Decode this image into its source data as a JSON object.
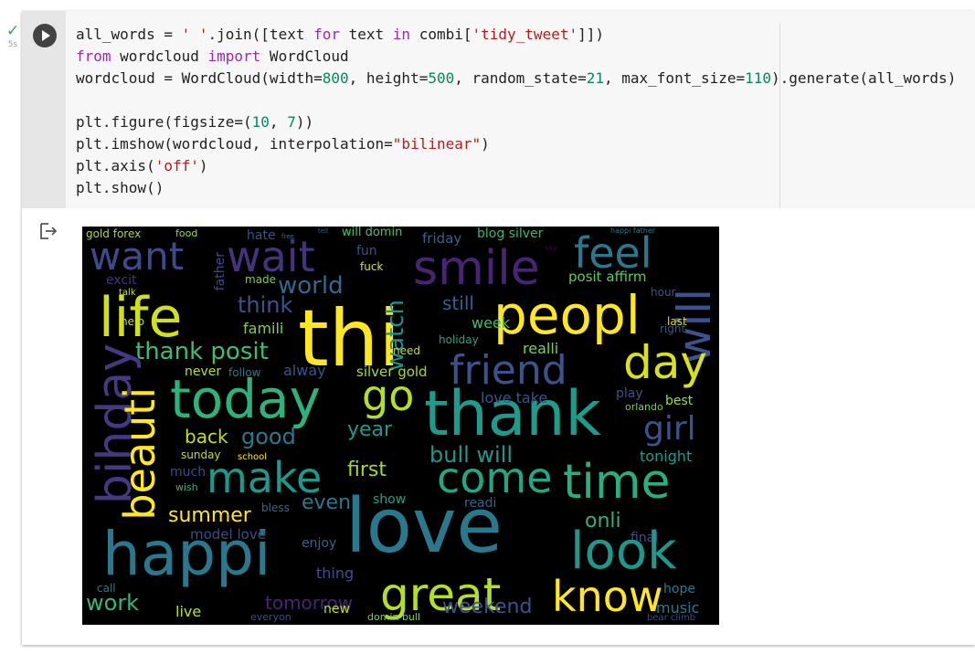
{
  "cell_status": {
    "check": "✓",
    "elapsed": "5s"
  },
  "code_lines": [
    [
      {
        "t": "all_words = ",
        "c": ""
      },
      {
        "t": "' '",
        "c": "str"
      },
      {
        "t": ".join([text ",
        "c": ""
      },
      {
        "t": "for",
        "c": "kw"
      },
      {
        "t": " text ",
        "c": ""
      },
      {
        "t": "in",
        "c": "kw"
      },
      {
        "t": " combi[",
        "c": ""
      },
      {
        "t": "'tidy_tweet'",
        "c": "str"
      },
      {
        "t": "]])",
        "c": ""
      }
    ],
    [
      {
        "t": "from",
        "c": "kw"
      },
      {
        "t": " wordcloud ",
        "c": ""
      },
      {
        "t": "import",
        "c": "kw"
      },
      {
        "t": " WordCloud",
        "c": ""
      }
    ],
    [
      {
        "t": "wordcloud = WordCloud(width=",
        "c": ""
      },
      {
        "t": "800",
        "c": "num"
      },
      {
        "t": ", height=",
        "c": ""
      },
      {
        "t": "500",
        "c": "num"
      },
      {
        "t": ", random_state=",
        "c": ""
      },
      {
        "t": "21",
        "c": "num"
      },
      {
        "t": ", max_font_size=",
        "c": ""
      },
      {
        "t": "110",
        "c": "num"
      },
      {
        "t": ").generate(all_words)",
        "c": ""
      }
    ],
    [],
    [
      {
        "t": "plt.figure(figsize=(",
        "c": ""
      },
      {
        "t": "10",
        "c": "num"
      },
      {
        "t": ", ",
        "c": ""
      },
      {
        "t": "7",
        "c": "num"
      },
      {
        "t": "))",
        "c": ""
      }
    ],
    [
      {
        "t": "plt.imshow(wordcloud, interpolation=",
        "c": ""
      },
      {
        "t": "\"bilinear\"",
        "c": "str"
      },
      {
        "t": ")",
        "c": ""
      }
    ],
    [
      {
        "t": "plt.axis(",
        "c": ""
      },
      {
        "t": "'off'",
        "c": "str"
      },
      {
        "t": ")",
        "c": ""
      }
    ],
    [
      {
        "t": "plt.show()",
        "c": ""
      }
    ]
  ],
  "wordcloud_words": [
    {
      "t": "gold forex",
      "c": "#a6d93a"
    },
    {
      "t": "food",
      "c": "#9bd93c"
    },
    {
      "t": "hate",
      "c": "#3b528b"
    },
    {
      "t": "free",
      "c": "#2d708e"
    },
    {
      "t": "tell",
      "c": "#33638d"
    },
    {
      "t": "will domin",
      "c": "#48c16e"
    },
    {
      "t": "friday",
      "c": "#33638d"
    },
    {
      "t": "blog silver",
      "c": "#35b779"
    },
    {
      "t": "happi father",
      "c": "#2a788e"
    },
    {
      "t": "want",
      "c": "#3e4a89"
    },
    {
      "t": "wait",
      "c": "#46337e"
    },
    {
      "t": "smile",
      "c": "#482475"
    },
    {
      "t": "feel",
      "c": "#2a788e"
    },
    {
      "t": "life",
      "c": "#d0e11c"
    },
    {
      "t": "thi",
      "c": "#fde725"
    },
    {
      "t": "peopl",
      "c": "#fde725"
    },
    {
      "t": "will",
      "c": "#3b528b"
    },
    {
      "t": "world",
      "c": "#31688e"
    },
    {
      "t": "think",
      "c": "#3b528b"
    },
    {
      "t": "watch",
      "c": "#21918c"
    },
    {
      "t": "posit affirm",
      "c": "#5ec962"
    },
    {
      "t": "father",
      "c": "#3e4a89"
    },
    {
      "t": "fun",
      "c": "#3b528b"
    },
    {
      "t": "fuck",
      "c": "#d8e219"
    },
    {
      "t": "say",
      "c": "#440154"
    },
    {
      "t": "excit",
      "c": "#46337e"
    },
    {
      "t": "made",
      "c": "#7ad151"
    },
    {
      "t": "talk",
      "c": "#c2df23"
    },
    {
      "t": "still",
      "c": "#33638d"
    },
    {
      "t": "hour",
      "c": "#3b528b"
    },
    {
      "t": "famili",
      "c": "#7ad151"
    },
    {
      "t": "week",
      "c": "#3fbc73"
    },
    {
      "t": "last",
      "c": "#d8e219"
    },
    {
      "t": "right",
      "c": "#3b528b"
    },
    {
      "t": "help",
      "c": "#c2df23"
    },
    {
      "t": "thank posit",
      "c": "#3fbc73"
    },
    {
      "t": "realli",
      "c": "#7ad151"
    },
    {
      "t": "holiday",
      "c": "#20a486"
    },
    {
      "t": "day",
      "c": "#d8e219"
    },
    {
      "t": "friend",
      "c": "#3b528b"
    },
    {
      "t": "bihday",
      "c": "#443983"
    },
    {
      "t": "never",
      "c": "#b5de2b"
    },
    {
      "t": "follow",
      "c": "#2a788e"
    },
    {
      "t": "alway",
      "c": "#3b528b"
    },
    {
      "t": "silver gold",
      "c": "#a0da39"
    },
    {
      "t": "need",
      "c": "#c2df23"
    },
    {
      "t": "today",
      "c": "#2db27d"
    },
    {
      "t": "go",
      "c": "#b5de2b"
    },
    {
      "t": "thank",
      "c": "#1e9b8a"
    },
    {
      "t": "love take",
      "c": "#3b528b"
    },
    {
      "t": "play",
      "c": "#3b528b"
    },
    {
      "t": "best",
      "c": "#a0da39"
    },
    {
      "t": "beauti",
      "c": "#fde725"
    },
    {
      "t": "orlando",
      "c": "#7ad151"
    },
    {
      "t": "girl",
      "c": "#3b528b"
    },
    {
      "t": "back",
      "c": "#c2df23"
    },
    {
      "t": "good",
      "c": "#2a788e"
    },
    {
      "t": "year",
      "c": "#1f988b"
    },
    {
      "t": "bull will",
      "c": "#1f988b"
    },
    {
      "t": "tonight",
      "c": "#1f988b"
    },
    {
      "t": "sunday",
      "c": "#c2df23"
    },
    {
      "t": "school",
      "c": "#fde725"
    },
    {
      "t": "make",
      "c": "#1f988b"
    },
    {
      "t": "first",
      "c": "#a0da39"
    },
    {
      "t": "come",
      "c": "#22a785"
    },
    {
      "t": "time",
      "c": "#29af7f"
    },
    {
      "t": "much",
      "c": "#3e4a89"
    },
    {
      "t": "wish",
      "c": "#35b779"
    },
    {
      "t": "summer",
      "c": "#fde725"
    },
    {
      "t": "bless",
      "c": "#31688e"
    },
    {
      "t": "even",
      "c": "#2a788e"
    },
    {
      "t": "show",
      "c": "#20a486"
    },
    {
      "t": "readi",
      "c": "#33638d"
    },
    {
      "t": "onli",
      "c": "#2db27d"
    },
    {
      "t": "love",
      "c": "#2a788e"
    },
    {
      "t": "happi",
      "c": "#2a788e"
    },
    {
      "t": "model love",
      "c": "#3e4a89"
    },
    {
      "t": "enjoy",
      "c": "#33638d"
    },
    {
      "t": "final",
      "c": "#3b528b"
    },
    {
      "t": "look",
      "c": "#1f988b"
    },
    {
      "t": "thing",
      "c": "#3b528b"
    },
    {
      "t": "great",
      "c": "#b5de2b"
    },
    {
      "t": "know",
      "c": "#fde725"
    },
    {
      "t": "tomorrow",
      "c": "#482475"
    },
    {
      "t": "work",
      "c": "#35b779"
    },
    {
      "t": "live",
      "c": "#b5de2b"
    },
    {
      "t": "weekend",
      "c": "#3b528b"
    },
    {
      "t": "new",
      "c": "#c2df23"
    },
    {
      "t": "music",
      "c": "#2a788e"
    },
    {
      "t": "hope",
      "c": "#2a788e"
    },
    {
      "t": "domin bull",
      "c": "#7ad151"
    },
    {
      "t": "bear climb",
      "c": "#3e4a89"
    },
    {
      "t": "call",
      "c": "#2a788e"
    },
    {
      "t": "everyon",
      "c": "#3e4a89"
    }
  ]
}
